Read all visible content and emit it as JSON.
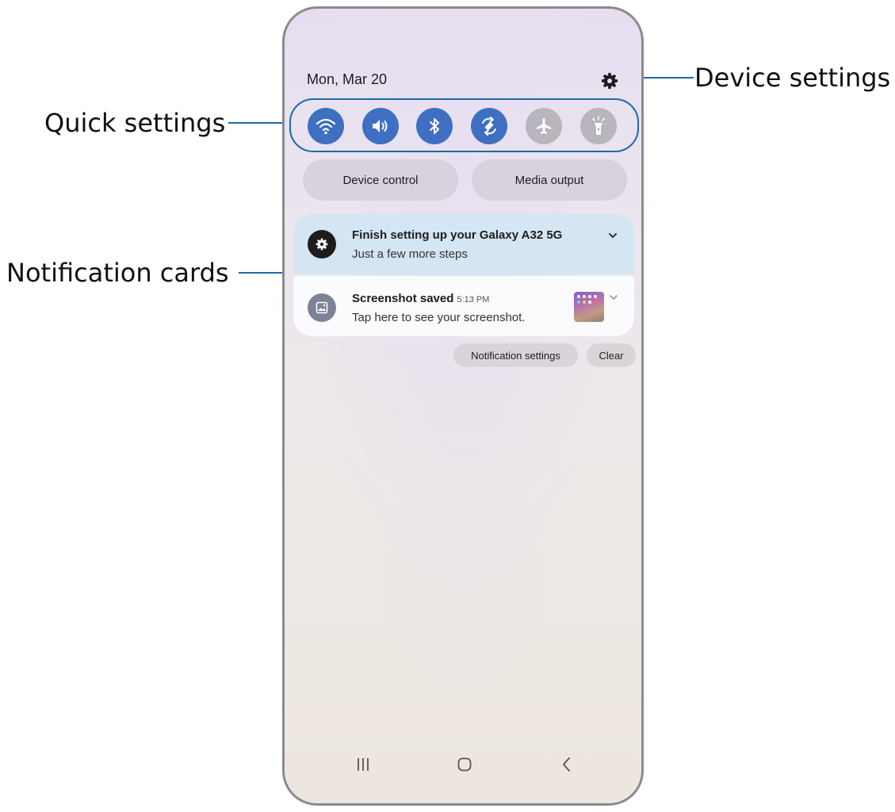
{
  "callouts": {
    "device_settings": "Device settings",
    "quick_settings": "Quick settings",
    "notification_cards": "Notification cards"
  },
  "status": {
    "date": "Mon, Mar 20"
  },
  "quick_settings": [
    {
      "icon": "wifi-icon",
      "state": "on"
    },
    {
      "icon": "sound-icon",
      "state": "on"
    },
    {
      "icon": "bluetooth-icon",
      "state": "on"
    },
    {
      "icon": "auto-rotate-icon",
      "state": "on"
    },
    {
      "icon": "airplane-mode-icon",
      "state": "off"
    },
    {
      "icon": "flashlight-icon",
      "state": "off"
    }
  ],
  "controls": {
    "device_control": "Device control",
    "media_output": "Media output"
  },
  "notifications": [
    {
      "icon": "settings-gear-icon",
      "title": "Finish setting up your Galaxy A32 5G",
      "text": "Just a few more steps"
    },
    {
      "icon": "gallery-icon",
      "title": "Screenshot saved",
      "time": "5:13 PM",
      "text": "Tap here to see your screenshot.",
      "thumbnail": "screenshot-thumbnail"
    }
  ],
  "actions": {
    "notification_settings": "Notification settings",
    "clear": "Clear"
  },
  "navbar": [
    "recent-apps-icon",
    "home-icon",
    "back-icon"
  ],
  "colors": {
    "accent": "#3e6fc3",
    "callout_line": "#1f6aa5",
    "card_highlight": "#d4e5f3"
  }
}
